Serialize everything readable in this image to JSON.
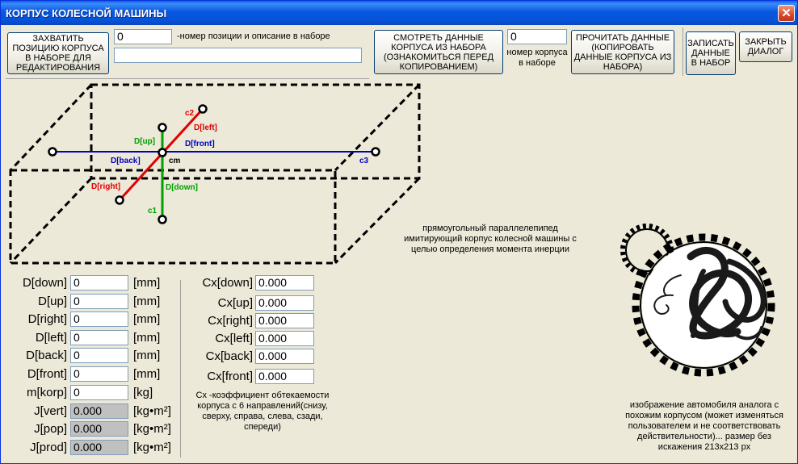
{
  "window": {
    "title": "КОРПУС КОЛЕСНОЙ МАШИНЫ",
    "close_glyph": "✕"
  },
  "toolbar": {
    "capture_button": "ЗАХВАТИТЬ ПОЗИЦИЮ КОРПУСА В НАБОРЕ ДЛЯ РЕДАКТИРОВАНИЯ",
    "position_value": "0",
    "position_caption": "-номер позиции и описание в наборе",
    "description_value": "",
    "view_button": "СМОТРЕТЬ ДАННЫЕ КОРПУСА ИЗ НАБОРА (ОЗНАКОМИТЬСЯ ПЕРЕД КОПИРОВАНИЕМ)",
    "body_number_value": "0",
    "body_number_caption": "номер корпуса в наборе",
    "read_button": "ПРОЧИТАТЬ ДАННЫЕ (КОПИРОВАТЬ ДАННЫЕ КОРПУСА ИЗ НАБОРА)",
    "write_button": "ЗАПИСАТЬ ДАННЫЕ В НАБОР",
    "close_button": "ЗАКРЫТЬ ДИАЛОГ"
  },
  "diagram": {
    "labels": {
      "c2": "c2",
      "d_left": "D[left]",
      "d_up": "D[up]",
      "d_front": "D[front]",
      "d_back": "D[back]",
      "cm": "cm",
      "c3": "c3",
      "d_right": "D[right]",
      "d_down": "D[down]",
      "c1": "c1"
    },
    "colors": {
      "red": "#E00000",
      "green": "#00A000",
      "blue": "#0000C0"
    },
    "caption": "прямоугольный параллелепипед имитирующий  корпус колесной машины с целью определения момента инерции"
  },
  "dimensions": [
    {
      "label": "D[down]",
      "value": "0",
      "unit": "[mm]"
    },
    {
      "label": "D[up]",
      "value": "0",
      "unit": "[mm]"
    },
    {
      "label": "D[right]",
      "value": "0",
      "unit": "[mm]"
    },
    {
      "label": "D[left]",
      "value": "0",
      "unit": "[mm]"
    },
    {
      "label": "D[back]",
      "value": "0",
      "unit": "[mm]"
    },
    {
      "label": "D[front]",
      "value": "0",
      "unit": "[mm]"
    },
    {
      "label": "m[korp]",
      "value": "0",
      "unit": "[kg]"
    },
    {
      "label": "J[vert]",
      "value": "0.000",
      "unit": "[kg•m²]"
    },
    {
      "label": "J[pop]",
      "value": "0.000",
      "unit": "[kg•m²]"
    },
    {
      "label": "J[prod]",
      "value": "0.000",
      "unit": "[kg•m²]"
    }
  ],
  "coefficients": [
    {
      "label": "Cx[down]",
      "value": "0.000"
    },
    {
      "label": "Cx[up]",
      "value": "0.000"
    },
    {
      "label": "Cx[right]",
      "value": "0.000"
    },
    {
      "label": "Cx[left]",
      "value": "0.000"
    },
    {
      "label": "Cx[back]",
      "value": "0.000"
    },
    {
      "label": "Cx[front]",
      "value": "0.000"
    }
  ],
  "cx_note": "Cx -коэффициент обтекаемости корпуса с 6 направлений(снизу, сверху, справа, слева, сзади, спереди)",
  "image_note": "изображение автомобиля аналога с похожим корпусом (может изменяться пользователем и не соответствовать действительности)... размер без искажения 213x213 px"
}
